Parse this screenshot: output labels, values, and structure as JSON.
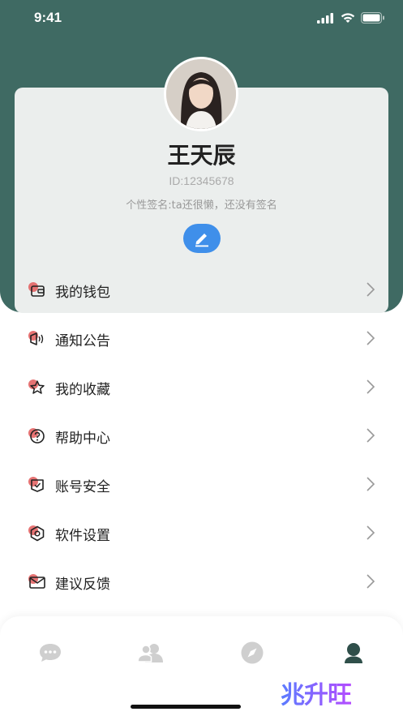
{
  "status_bar": {
    "time": "9:41"
  },
  "profile": {
    "name": "王天辰",
    "id_text": "ID:12345678",
    "signature": "个性签名:ta还很懒，还没有签名"
  },
  "menu": {
    "items": [
      {
        "label": "我的钱包",
        "icon": "wallet-icon"
      },
      {
        "label": "通知公告",
        "icon": "speaker-icon"
      },
      {
        "label": "我的收藏",
        "icon": "star-icon"
      },
      {
        "label": "帮助中心",
        "icon": "help-icon"
      },
      {
        "label": "账号安全",
        "icon": "shield-icon"
      },
      {
        "label": "软件设置",
        "icon": "settings-icon"
      },
      {
        "label": "建议反馈",
        "icon": "mail-icon"
      }
    ]
  },
  "tabs": [
    {
      "name": "messages",
      "icon": "chat-icon",
      "active": false
    },
    {
      "name": "contacts",
      "icon": "contacts-icon",
      "active": false
    },
    {
      "name": "discover",
      "icon": "compass-icon",
      "active": false
    },
    {
      "name": "me",
      "icon": "user-icon",
      "active": true
    }
  ],
  "watermark": "兆升旺",
  "colors": {
    "header": "#3f6a63",
    "card": "#ebeeed",
    "accent_blue": "#3f8fea",
    "icon_red": "#e25b5b",
    "tab_inactive": "#cfcfcf",
    "tab_active": "#2f4f4a"
  }
}
